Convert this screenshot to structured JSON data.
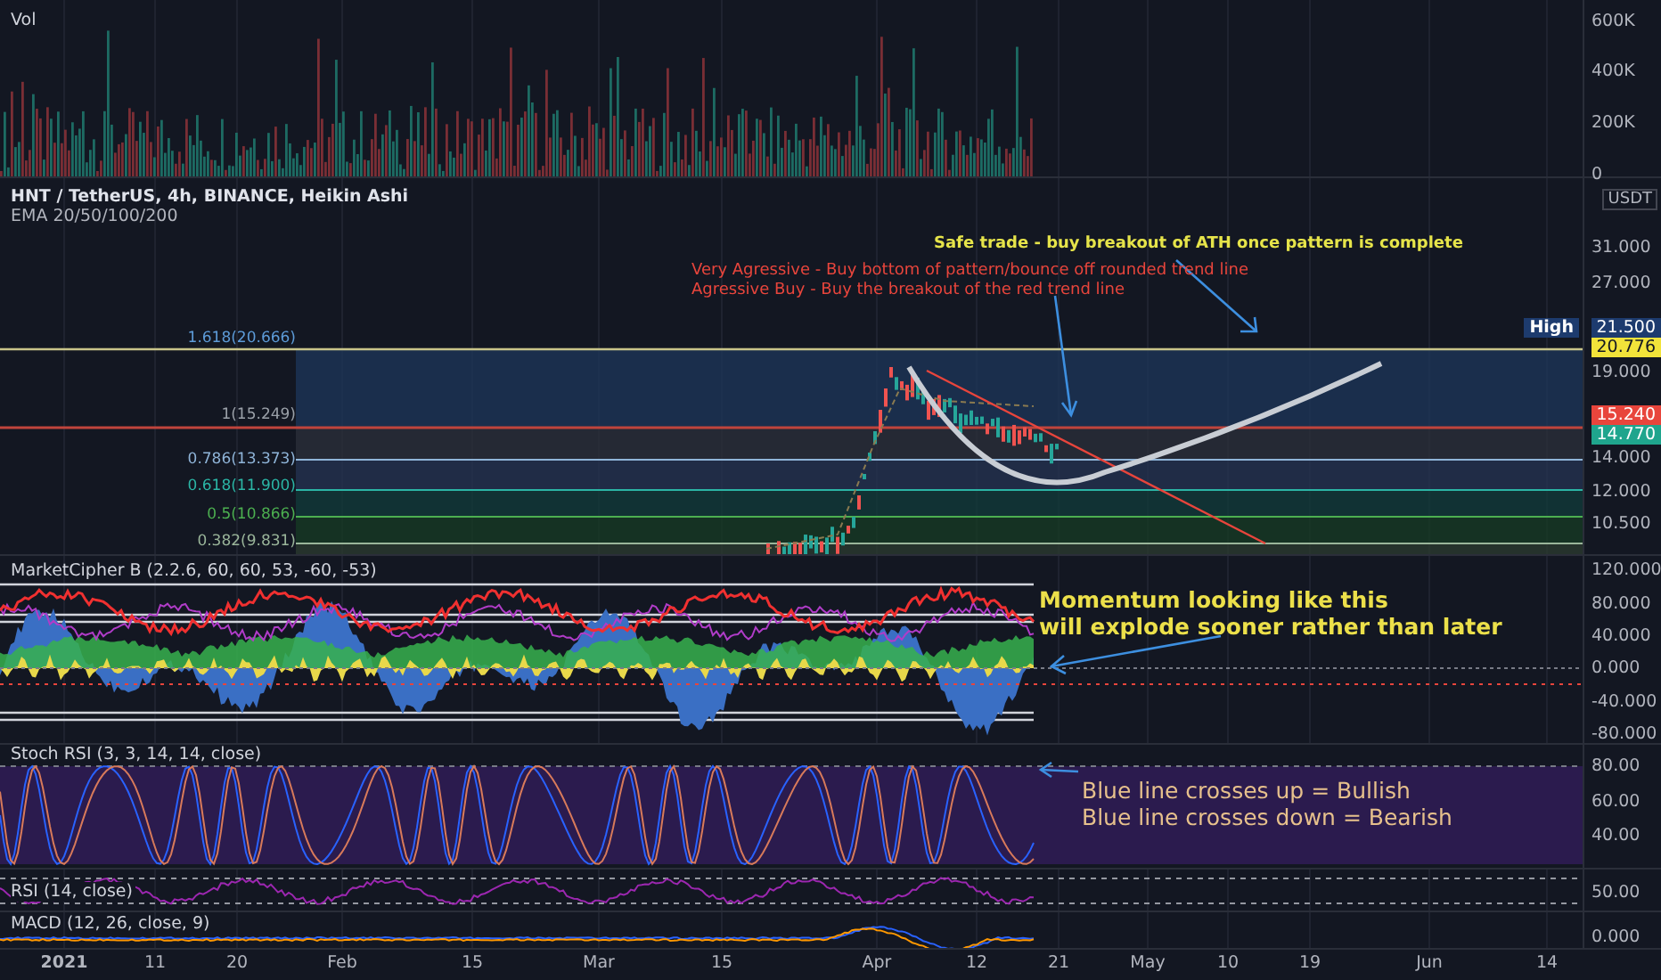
{
  "volume_pane": {
    "legend": "Vol",
    "axis_labels": [
      "600K",
      "400K",
      "200K",
      "0"
    ]
  },
  "price_pane": {
    "legend": [
      "HNT / TetherUS, 4h, BINANCE, Heikin Ashi",
      "EMA 20/50/100/200"
    ],
    "currency": "USDT",
    "axis_labels": [
      "31.000",
      "27.000",
      "19.000",
      "14.000",
      "12.000",
      "10.500"
    ],
    "price_tags": [
      {
        "label": "High",
        "value": "21.500",
        "color": "#1d3b6e"
      },
      {
        "value": "20.776",
        "color": "#f2e33a"
      },
      {
        "value": "15.240",
        "color": "#e8453c"
      },
      {
        "value": "14.770",
        "color": "#1fa58d"
      }
    ],
    "fib_levels": [
      {
        "label": "1.618(20.666)",
        "color": "#5d9bd8"
      },
      {
        "label": "1(15.249)",
        "color": "#9aa0a8"
      },
      {
        "label": "0.786(13.373)",
        "color": "#8fb4d8"
      },
      {
        "label": "0.618(11.900)",
        "color": "#2bb5a5"
      },
      {
        "label": "0.5(10.866)",
        "color": "#4caf50"
      },
      {
        "label": "0.382(9.831)",
        "color": "#9ab59a"
      }
    ],
    "annotations": [
      {
        "text": "Safe trade - buy breakout of ATH once pattern is complete",
        "color": "#e6e44a"
      },
      {
        "text": "Very Agressive - Buy bottom of pattern/bounce off rounded trend line",
        "color": "#e8453c"
      },
      {
        "text": "Agressive Buy - Buy the breakout of the red trend line",
        "color": "#e8453c"
      }
    ]
  },
  "market_cipher_pane": {
    "legend": "MarketCipher B (2.2.6, 60, 60, 53, -60, -53)",
    "axis_labels": [
      "120.000",
      "80.000",
      "40.000",
      "0.000",
      "-40.000",
      "-80.000"
    ],
    "note": [
      "Momentum looking like this",
      "will explode sooner rather than later"
    ]
  },
  "stoch_rsi_pane": {
    "legend": "Stoch RSI (3, 3, 14, 14, close)",
    "axis_labels": [
      "80.00",
      "60.00",
      "40.00"
    ],
    "note": [
      "Blue line crosses up = Bullish",
      "Blue line crosses down = Bearish"
    ]
  },
  "rsi_pane": {
    "legend": "RSI (14, close)",
    "axis_labels": [
      "50.00"
    ]
  },
  "macd_pane": {
    "legend": "MACD (12, 26, close, 9)",
    "axis_labels": [
      "0.000"
    ]
  },
  "time_axis": [
    {
      "label": "2021",
      "bold": true
    },
    {
      "label": "11",
      "bold": false
    },
    {
      "label": "20",
      "bold": false
    },
    {
      "label": "Feb",
      "bold": false
    },
    {
      "label": "15",
      "bold": false
    },
    {
      "label": "Mar",
      "bold": false
    },
    {
      "label": "15",
      "bold": false
    },
    {
      "label": "Apr",
      "bold": false
    },
    {
      "label": "12",
      "bold": false
    },
    {
      "label": "21",
      "bold": false
    },
    {
      "label": "May",
      "bold": false
    },
    {
      "label": "10",
      "bold": false
    },
    {
      "label": "19",
      "bold": false
    },
    {
      "label": "Jun",
      "bold": false
    },
    {
      "label": "14",
      "bold": false
    }
  ]
}
